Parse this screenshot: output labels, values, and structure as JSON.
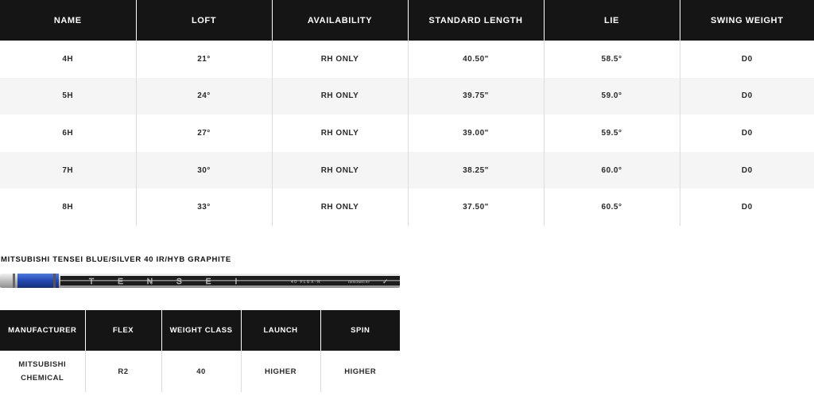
{
  "specs_table": {
    "headers": [
      "NAME",
      "LOFT",
      "AVAILABILITY",
      "STANDARD LENGTH",
      "LIE",
      "SWING WEIGHT"
    ],
    "rows": [
      [
        "4H",
        "21°",
        "RH ONLY",
        "40.50\"",
        "58.5°",
        "D0"
      ],
      [
        "5H",
        "24°",
        "RH ONLY",
        "39.75\"",
        "59.0°",
        "D0"
      ],
      [
        "6H",
        "27°",
        "RH ONLY",
        "39.00\"",
        "59.5°",
        "D0"
      ],
      [
        "7H",
        "30°",
        "RH ONLY",
        "38.25\"",
        "60.0°",
        "D0"
      ],
      [
        "8H",
        "33°",
        "RH ONLY",
        "37.50\"",
        "60.5°",
        "D0"
      ]
    ]
  },
  "shaft": {
    "title": "MITSUBISHI TENSEI BLUE/SILVER 40 IR/HYB GRAPHITE",
    "image_text": {
      "brand": "TENSEI",
      "flex": "40 FLEX-R",
      "designed_by": "DESIGNED BY"
    },
    "colors": {
      "band": "#2a56c6",
      "shaft": "#c8c8c8",
      "graphic": "#1c1c1c"
    }
  },
  "shaft_table": {
    "headers": [
      "MANUFACTURER",
      "FLEX",
      "WEIGHT CLASS",
      "LAUNCH",
      "SPIN"
    ],
    "row": {
      "manufacturer_line1": "MITSUBISHI",
      "manufacturer_line2": "CHEMICAL",
      "flex": "R2",
      "weight_class": "40",
      "launch": "HIGHER",
      "spin": "HIGHER"
    }
  }
}
